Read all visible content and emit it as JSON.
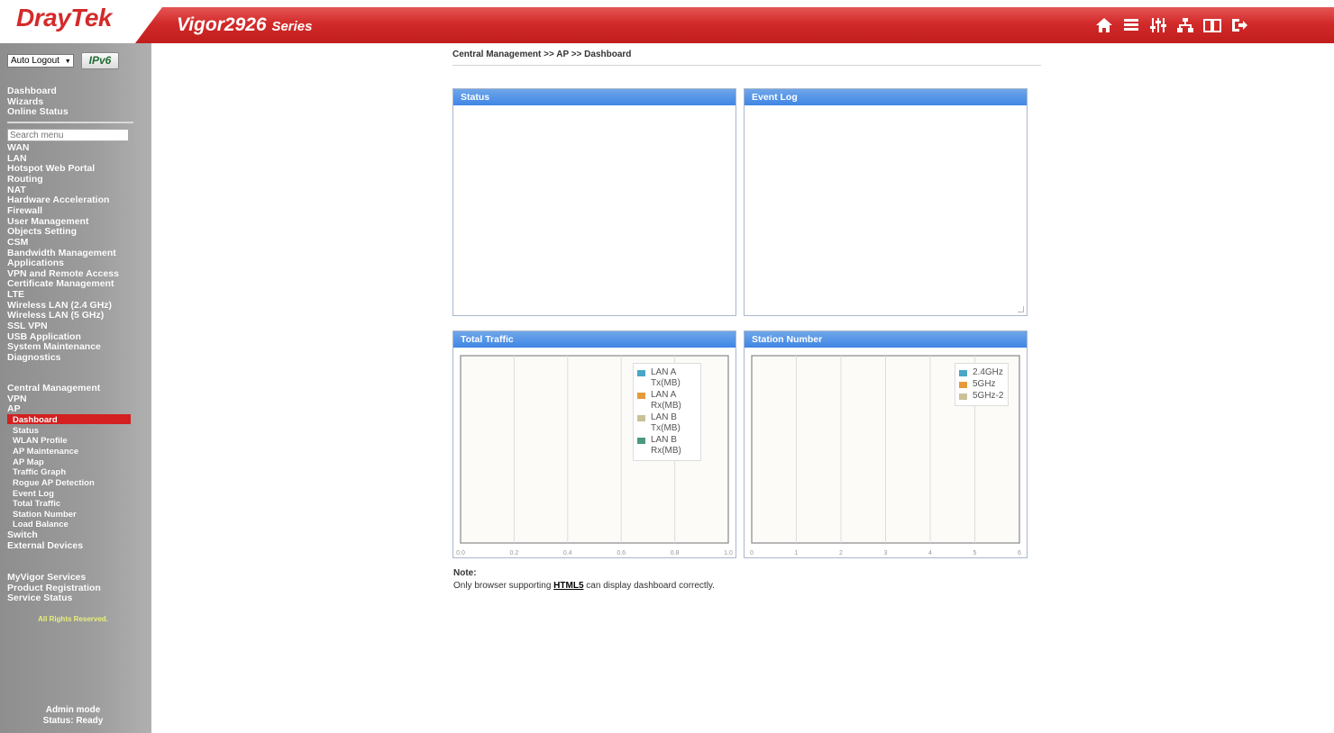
{
  "header": {
    "logo": "DrayTek",
    "product": "Vigor2926",
    "series": "Series",
    "toolbar": [
      {
        "name": "home-icon"
      },
      {
        "name": "list-icon"
      },
      {
        "name": "sliders-icon"
      },
      {
        "name": "sitemap-icon"
      },
      {
        "name": "book-icon"
      },
      {
        "name": "logout-icon"
      }
    ]
  },
  "sidebar": {
    "auto_logout": "Auto Logout",
    "ipv6": "IPv6",
    "search_placeholder": "Search menu",
    "top_items": [
      "Dashboard",
      "Wizards",
      "Online Status"
    ],
    "items": [
      "WAN",
      "LAN",
      "Hotspot Web Portal",
      "Routing",
      "NAT",
      "Hardware Acceleration",
      "Firewall",
      "User Management",
      "Objects Setting",
      "CSM",
      "Bandwidth Management",
      "Applications",
      "VPN and Remote Access",
      "Certificate Management",
      "LTE",
      "Wireless LAN (2.4 GHz)",
      "Wireless LAN (5 GHz)",
      "SSL VPN",
      "USB Application",
      "System Maintenance",
      "Diagnostics"
    ],
    "central": [
      "Central Management",
      "VPN",
      "AP"
    ],
    "ap_sub": [
      "Dashboard",
      "Status",
      "WLAN Profile",
      "AP Maintenance",
      "AP Map",
      "Traffic Graph",
      "Rogue AP Detection",
      "Event Log",
      "Total Traffic",
      "Station Number",
      "Load Balance"
    ],
    "after": [
      "Switch",
      "External Devices"
    ],
    "services": [
      "MyVigor Services",
      "Product Registration",
      "Service Status"
    ],
    "rights": "All Rights Reserved.",
    "mode": "Admin mode",
    "status": "Status: Ready"
  },
  "main": {
    "breadcrumb": "Central Management >> AP >> Dashboard",
    "panels": {
      "status": "Status",
      "event_log": "Event Log",
      "total_traffic": "Total Traffic",
      "station_number": "Station Number"
    },
    "note": {
      "label": "Note:",
      "pre": "Only browser supporting ",
      "link": "HTML5",
      "post": " can display dashboard correctly."
    }
  },
  "chart_data": [
    {
      "type": "line",
      "x_ticks": [
        "0.0",
        "0.2",
        "0.4",
        "0.6",
        "0.8",
        "1.0"
      ],
      "xlim": [
        0,
        1
      ],
      "grid": true,
      "legend_position": "top-right",
      "series": [
        {
          "name": "LAN A Tx(MB)",
          "color": "#4aa6c6",
          "values": []
        },
        {
          "name": "LAN A Rx(MB)",
          "color": "#e79a3b",
          "values": []
        },
        {
          "name": "LAN B Tx(MB)",
          "color": "#cbc197",
          "values": []
        },
        {
          "name": "LAN B Rx(MB)",
          "color": "#4c9a7c",
          "values": []
        }
      ]
    },
    {
      "type": "line",
      "x_ticks": [
        "0",
        "1",
        "2",
        "3",
        "4",
        "5",
        "6"
      ],
      "xlim": [
        0,
        6
      ],
      "grid": true,
      "legend_position": "top-right",
      "series": [
        {
          "name": "2.4GHz",
          "color": "#4aa6c6",
          "values": []
        },
        {
          "name": "5GHz",
          "color": "#e79a3b",
          "values": []
        },
        {
          "name": "5GHz-2",
          "color": "#cbc197",
          "values": []
        }
      ]
    }
  ]
}
